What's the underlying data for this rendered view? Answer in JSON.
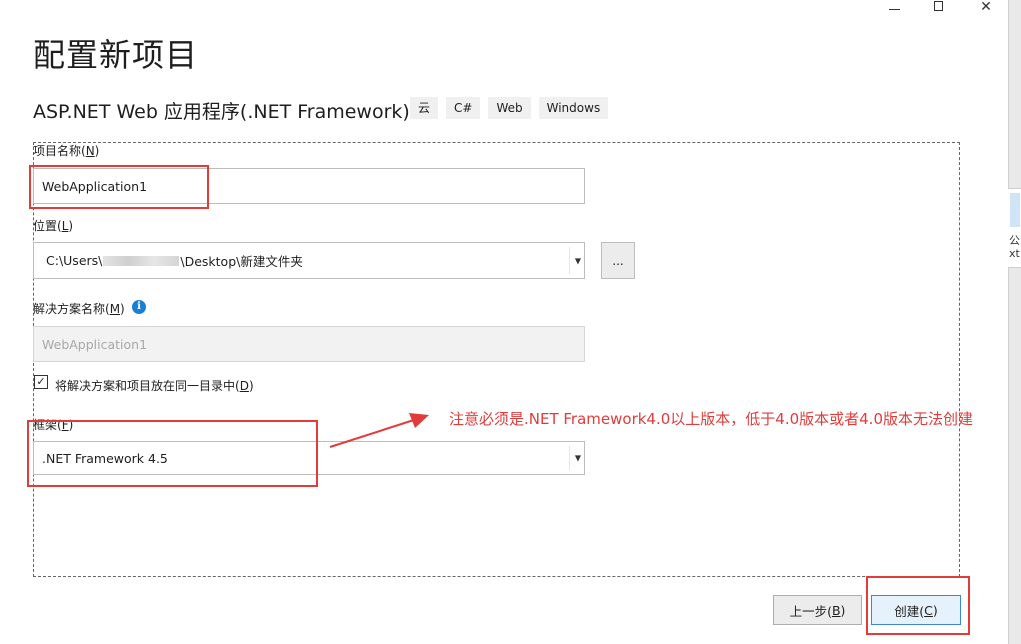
{
  "window": {
    "minimize_label": "",
    "close_glyph": "✕"
  },
  "page": {
    "title": "配置新项目",
    "project_type": "ASP.NET Web 应用程序(.NET Framework)",
    "tags": [
      "云",
      "C#",
      "Web",
      "Windows"
    ]
  },
  "form": {
    "project_name_label": "项目名称(",
    "project_name_key": "N",
    "project_name_value": "WebApplication1",
    "location_label": "位置(",
    "location_key": "L",
    "location_value": "C:\\Users\\",
    "location_value_rest": "\\Desktop\\新建文件夹",
    "browse_label": "...",
    "solution_name_label": "解决方案名称(",
    "solution_name_key": "M",
    "solution_name_placeholder": "WebApplication1",
    "same_dir_checked": true,
    "same_dir_label": "将解决方案和项目放在同一目录中(",
    "same_dir_key": "D",
    "framework_label": "框架(",
    "framework_key": "F",
    "framework_value": ".NET Framework 4.5"
  },
  "annotation": {
    "text": "注意必须是.NET Framework4.0以上版本，低于4.0版本或者4.0版本无法创建",
    "color": "#e03c3c"
  },
  "buttons": {
    "back_label": "上一步(",
    "back_key": "B",
    "create_label": "创建(",
    "create_key": "C"
  },
  "right_edge": {
    "text": "公 xt"
  },
  "colors": {
    "accent": "#1a7fd4",
    "highlight": "#e03c3c"
  }
}
